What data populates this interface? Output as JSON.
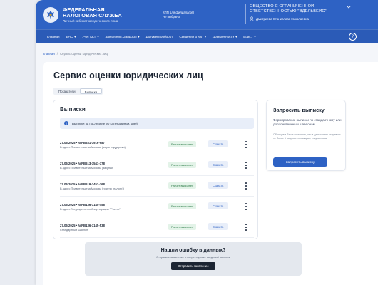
{
  "header": {
    "brand_line1": "ФЕДЕРАЛЬНАЯ",
    "brand_line2": "НАЛОГОВАЯ СЛУЖБА",
    "brand_sub": "Личный кабинет юридического лица",
    "inn_label": "КПП для филиала(ов)",
    "inn_value": "Не выбрано",
    "org_line1": "ОБЩЕСТВО С ОГРАНИЧЕННОЙ",
    "org_line2": "ОТВЕТСТВЕННОСТЬЮ \"ЭДЕЛЬВЕЙС\"",
    "org_user": "Дмитриева Станислава Николаевна"
  },
  "nav": {
    "items": [
      {
        "label": "Главная",
        "chevron": false
      },
      {
        "label": "ЕНС",
        "chevron": true
      },
      {
        "label": "Учет ККТ",
        "chevron": true
      },
      {
        "label": "Заявления. Запросы",
        "chevron": true
      },
      {
        "label": "Документооборот",
        "chevron": false
      },
      {
        "label": "Сведения о ЮЛ",
        "chevron": true
      },
      {
        "label": "Доверенности",
        "chevron": true
      },
      {
        "label": "Еще...",
        "chevron": true
      }
    ],
    "help": "?"
  },
  "breadcrumb": {
    "home": "Главная",
    "sep": "/",
    "current": "Сервис оценки юридических лиц"
  },
  "page": {
    "title": "Сервис оценки юридических лиц",
    "tabs": [
      {
        "label": "Показатели",
        "active": false
      },
      {
        "label": "Выписки",
        "active": true
      }
    ]
  },
  "extracts": {
    "title": "Выписки",
    "info": "Выписки за последние 90 календарных дней",
    "rows": [
      {
        "id": "27.06.2025 • №РВ631-3916-987",
        "addr": "В адрес Правительства Москвы (меры поддержки)",
        "status": "Расчет выполнен",
        "action": "Скачать"
      },
      {
        "id": "27.06.2025 • №РВ613-3541-378",
        "addr": "В адрес Правительства Москвы (закупки)",
        "status": "Расчет выполнен",
        "action": "Скачать"
      },
      {
        "id": "27.06.2025 • №РВ619-3451-368",
        "addr": "В адрес Правительства Москвы (гранты (налоги))",
        "status": "Расчет выполнен",
        "action": "Скачать"
      },
      {
        "id": "27.06.2025 • №РВ136-3145-458",
        "addr": "В адрес Государственной корпорации \"Ростех\"",
        "status": "Расчет выполнен",
        "action": "Скачать"
      },
      {
        "id": "27.06.2025 • №РВ136-3145-538",
        "addr": "Стандартный шаблон",
        "status": "Расчет выполнен",
        "action": "Скачать"
      }
    ]
  },
  "request": {
    "title": "Запросить выписку",
    "desc": "Формирование выписки по стандартному или дополнительным шаблонам",
    "note": "Обращаем Ваше внимание, что в день можно отправить не более 1 запроса по каждому типу выписки",
    "button": "Запросить выписку"
  },
  "error_box": {
    "title": "Нашли ошибку в данных?",
    "sub": "Отправьте заявление о корректировке сведений выписки",
    "button": "Отправить заявление"
  },
  "colors": {
    "primary": "#2e62c4",
    "status_green": "#2b7a47"
  }
}
